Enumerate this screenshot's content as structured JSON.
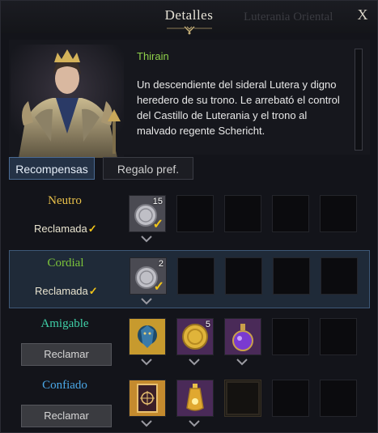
{
  "window": {
    "title": "Detalles",
    "background_text": "Luterania Oriental",
    "close_label": "X"
  },
  "npc": {
    "name": "Thirain",
    "description": "Un descendiente del sideral Lutera y digno heredero de su trono. Le arrebató el control del Castillo de Luterania y el trono al malvado regente Schericht."
  },
  "tabs": [
    {
      "label": "Recompensas",
      "active": true
    },
    {
      "label": "Regalo pref.",
      "active": false
    }
  ],
  "tiers": [
    {
      "name": "Neutro",
      "color": "#e8c04a",
      "status": "Reclamada",
      "claimed": true,
      "rewards": [
        {
          "icon": "silver-coin-icon",
          "count": "15",
          "checked": true
        }
      ]
    },
    {
      "name": "Cordial",
      "color": "#7cc43a",
      "status": "Reclamada",
      "claimed": true,
      "rewards": [
        {
          "icon": "silver-coin-icon",
          "count": "2",
          "checked": true
        }
      ]
    },
    {
      "name": "Amigable",
      "color": "#3fd0a8",
      "button": "Reclamar",
      "claimed": false,
      "rewards": [
        {
          "icon": "lion-crest-icon",
          "count": ""
        },
        {
          "icon": "gold-coin-icon",
          "count": "5"
        },
        {
          "icon": "purple-potion-icon",
          "count": ""
        }
      ]
    },
    {
      "name": "Confiado",
      "color": "#4aa8e8",
      "button": "Reclamar",
      "claimed": false,
      "rewards": [
        {
          "icon": "card-icon",
          "count": ""
        },
        {
          "icon": "gold-elixir-icon",
          "count": ""
        },
        {
          "icon": "locked-slot-icon",
          "count": ""
        }
      ]
    }
  ],
  "colors": {
    "accent": "#f0c419",
    "npc_name": "#8fd14a",
    "selected_row": "#1f2a38"
  }
}
